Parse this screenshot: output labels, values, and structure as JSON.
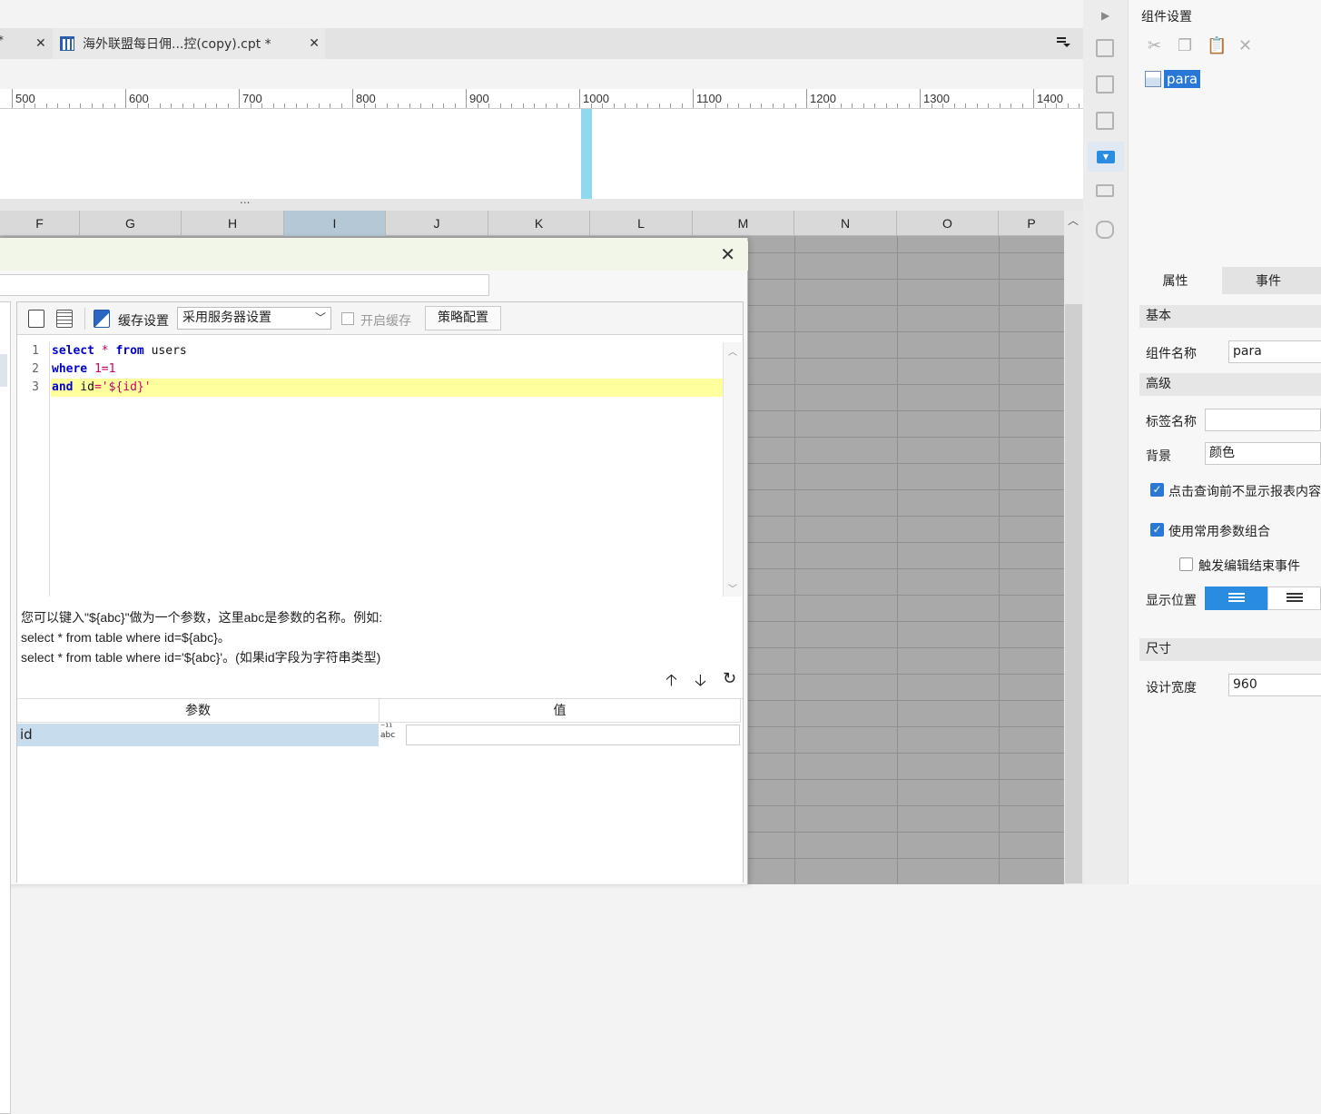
{
  "tabs": {
    "prev_tab_suffix": "*",
    "prev_tab_close": "✕",
    "active_tab_title": "海外联盟每日佣...控(copy).cpt *",
    "active_tab_close": "✕",
    "menu_icon": "tab-list-icon"
  },
  "ruler": {
    "labels": [
      "500",
      "600",
      "700",
      "800",
      "900",
      "1000",
      "1100",
      "1200",
      "1300",
      "1400"
    ]
  },
  "splitter_dots": "...",
  "grid": {
    "columns": [
      "F",
      "G",
      "H",
      "I",
      "J",
      "K",
      "L",
      "M",
      "N",
      "O",
      "P"
    ],
    "selected_column": "I"
  },
  "dialog": {
    "close": "✕",
    "toolbar": {
      "cache_label": "缓存设置",
      "cache_select_value": "采用服务器设置",
      "enable_cache_label": "开启缓存",
      "strategy_button": "策略配置"
    },
    "editor": {
      "line_numbers": [
        "1",
        "2",
        "3"
      ]
    },
    "hint_lines": [
      "您可以键入\"${abc}\"做为一个参数，这里abc是参数的名称。例如:",
      "select * from table where id=${abc}。",
      "select * from table where id='${abc}'。(如果id字段为字符串类型)"
    ],
    "param_table": {
      "headers": [
        "参数",
        "值"
      ],
      "rows": [
        {
          "name": "id",
          "value": ""
        }
      ],
      "type_glyph": "abc"
    }
  },
  "panel": {
    "title": "组件设置",
    "tree_item": "para",
    "tabs": [
      "属性",
      "事件"
    ],
    "sections": {
      "basic": "基本",
      "advanced": "高级",
      "size": "尺寸"
    },
    "fields": {
      "component_name_label": "组件名称",
      "component_name_value": "para",
      "tag_name_label": "标签名称",
      "tag_name_value": "",
      "background_label": "背景",
      "background_value": "颜色",
      "hide_report_label": "点击查询前不显示报表内容",
      "use_common_params_label": "使用常用参数组合",
      "trigger_edit_end_label": "触发编辑结束事件",
      "display_position_label": "显示位置",
      "design_width_label": "设计宽度",
      "design_width_value": "960"
    },
    "checkboxes": {
      "hide_report": true,
      "use_common_params": true,
      "trigger_edit_end": false
    }
  },
  "colors": {
    "accent": "#2a78d5",
    "grid_bg": "#a9a9a9",
    "editor_highlight": "#ffff9e",
    "selected_param_row": "#c7dcec"
  }
}
